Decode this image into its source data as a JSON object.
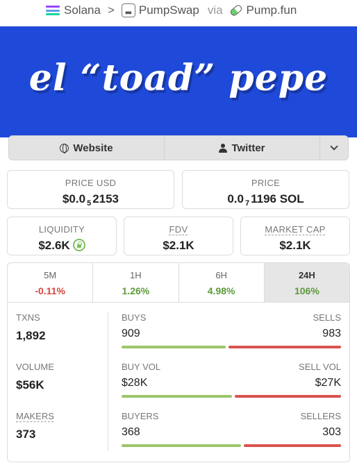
{
  "breadcrumb": {
    "chain": "Solana",
    "dex": "PumpSwap",
    "via": "via",
    "launchpad": "Pump.fun"
  },
  "banner": {
    "title": "el “toad” pepe"
  },
  "links": {
    "website": "Website",
    "twitter": "Twitter"
  },
  "price_usd": {
    "label": "PRICE USD",
    "prefix": "$0.0",
    "zeros": "5",
    "digits": "2153"
  },
  "price_native": {
    "label": "PRICE",
    "prefix": "0.0",
    "zeros": "7",
    "digits": "1196 SOL"
  },
  "liquidity": {
    "label": "LIQUIDITY",
    "value": "$2.6K"
  },
  "fdv": {
    "label": "FDV",
    "value": "$2.1K"
  },
  "market_cap": {
    "label": "MARKET CAP",
    "value": "$2.1K"
  },
  "timeframes": [
    {
      "label": "5M",
      "change": "-0.11%"
    },
    {
      "label": "1H",
      "change": "1.26%"
    },
    {
      "label": "6H",
      "change": "4.98%"
    },
    {
      "label": "24H",
      "change": "106%"
    }
  ],
  "stats": {
    "txns": {
      "label": "TXNS",
      "value": "1,892",
      "left_label": "BUYS",
      "left_value": "909",
      "right_label": "SELLS",
      "right_value": "983",
      "buy_fraction": 0.48
    },
    "volume": {
      "label": "VOLUME",
      "value": "$56K",
      "left_label": "BUY VOL",
      "left_value": "$28K",
      "right_label": "SELL VOL",
      "right_value": "$27K",
      "buy_fraction": 0.51
    },
    "makers": {
      "label": "MAKERS",
      "value": "373",
      "left_label": "BUYERS",
      "left_value": "368",
      "right_label": "SELLERS",
      "right_value": "303",
      "buy_fraction": 0.55
    }
  },
  "colors": {
    "banner": "#1f49d8",
    "positive": "#5c9a3a",
    "negative": "#d8463f",
    "buy_bar": "#9dc66a",
    "sell_bar": "#d9534f"
  }
}
